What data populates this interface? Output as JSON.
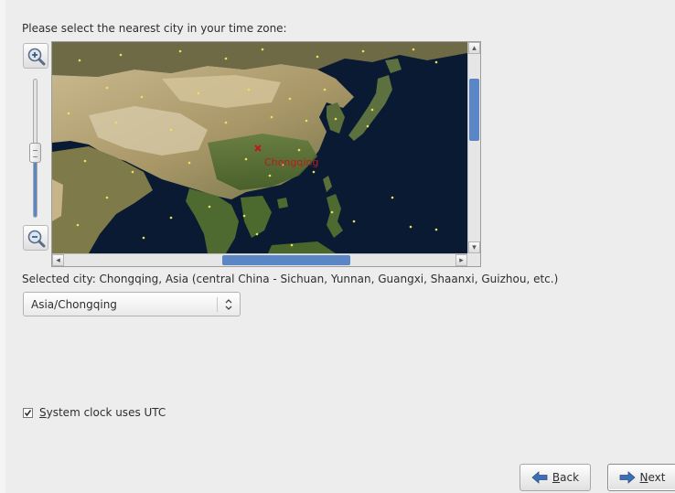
{
  "prompt_text": "Please select the nearest city in your time zone:",
  "zoom": {
    "zoom_in_icon": "zoom-in-icon",
    "zoom_out_icon": "zoom-out-icon",
    "level_fraction": 0.47
  },
  "map": {
    "highlighted_city_label": "Chongqing",
    "marker_color": "#c0191c",
    "ocean_color": "#0b1a33",
    "vertical_scroll_fraction": 0.2,
    "horizontal_scroll_fraction": 0.6
  },
  "selected_city_text": "Selected city: Chongqing, Asia (central China - Sichuan, Yunnan, Guangxi, Shaanxi, Guizhou, etc.)",
  "timezone_select": {
    "value": "Asia/Chongqing",
    "chevron_icon": "updown-chevron-icon"
  },
  "utc_checkbox": {
    "checked": true,
    "label_mnemonic": "S",
    "label_rest": "ystem clock uses UTC"
  },
  "buttons": {
    "back": {
      "mnemonic": "B",
      "rest": "ack",
      "icon": "arrow-left-icon"
    },
    "next": {
      "mnemonic": "N",
      "rest": "ext",
      "icon": "arrow-right-icon"
    }
  },
  "colors": {
    "accent": "#5a86c6",
    "arrow_icon": "#3e6fb6"
  }
}
